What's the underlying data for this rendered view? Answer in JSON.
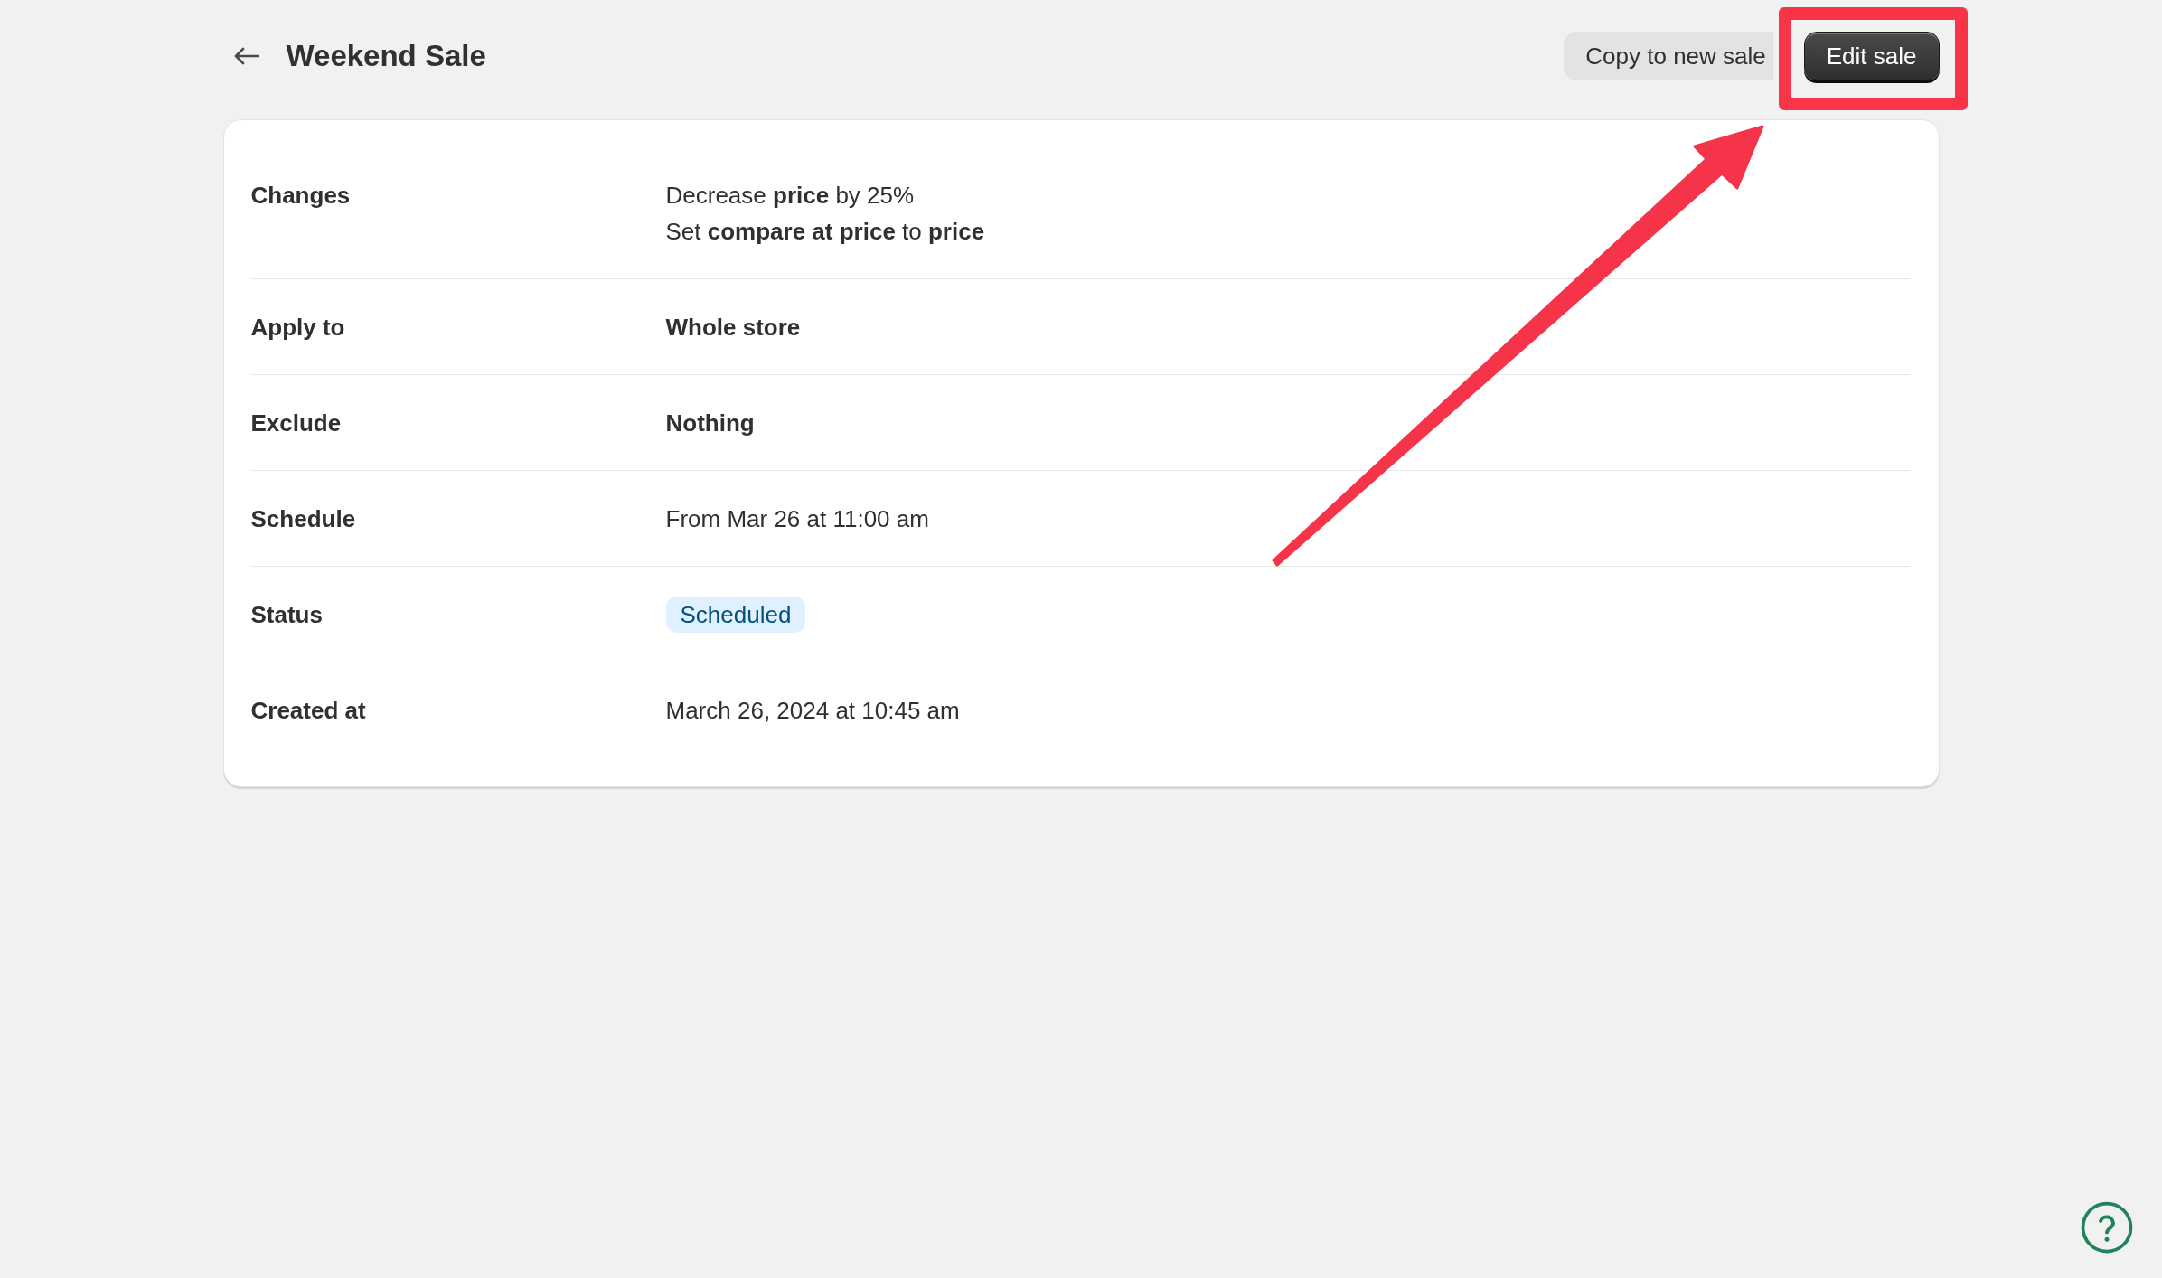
{
  "header": {
    "title": "Weekend Sale",
    "actions": [
      {
        "label": "Copy to new sale",
        "kind": "secondary"
      },
      {
        "label": "Edit sale",
        "kind": "primary"
      }
    ]
  },
  "details": [
    {
      "label": "Changes",
      "kind": "lines",
      "lines": [
        "Decrease **price** by 25%",
        "Set **compare at price** to **price**"
      ]
    },
    {
      "label": "Apply to",
      "kind": "strong",
      "value": "Whole store"
    },
    {
      "label": "Exclude",
      "kind": "strong",
      "value": "Nothing"
    },
    {
      "label": "Schedule",
      "kind": "plain",
      "value": "From Mar 26 at 11:00 am"
    },
    {
      "label": "Status",
      "kind": "badge",
      "value": "Scheduled"
    },
    {
      "label": "Created at",
      "kind": "plain",
      "value": "March 26, 2024 at 10:45 am"
    }
  ]
}
